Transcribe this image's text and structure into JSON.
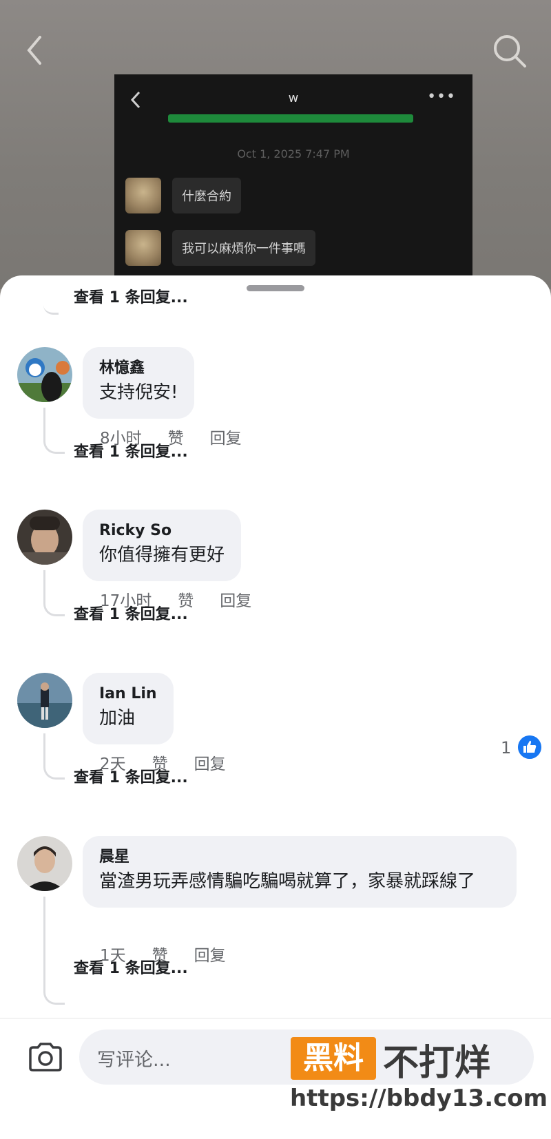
{
  "screenshot": {
    "chat_title": "w",
    "timestamp": "Oct 1, 2025 7:47 PM",
    "messages": [
      "什麼合約",
      "我可以麻煩你一件事嗎"
    ]
  },
  "comments": {
    "view_replies_label": "查看 1 条回复...",
    "items": [
      {
        "name": "林憶鑫",
        "text": "支持倪安!",
        "time": "8小时",
        "like_label": "赞",
        "reply_label": "回复"
      },
      {
        "name": "Ricky So",
        "text": "你值得擁有更好",
        "time": "17小时",
        "like_label": "赞",
        "reply_label": "回复"
      },
      {
        "name": "Ian Lin",
        "text": "加油",
        "time": "2天",
        "like_label": "赞",
        "reply_label": "回复",
        "likes": "1"
      },
      {
        "name": "晨星",
        "text": "當渣男玩弄感情騙吃騙喝就算了，家暴就踩線了",
        "time": "1天",
        "like_label": "赞",
        "reply_label": "回复"
      }
    ]
  },
  "composer": {
    "placeholder": "写评论..."
  },
  "watermark": {
    "badge": "黑料",
    "text": "不打烊",
    "url": "https://bbdy13.com"
  },
  "colors": {
    "like_blue": "#1877f2",
    "bubble": "#f0f1f5",
    "meta_gray": "#65676b",
    "watermark_orange": "#f28b16"
  }
}
